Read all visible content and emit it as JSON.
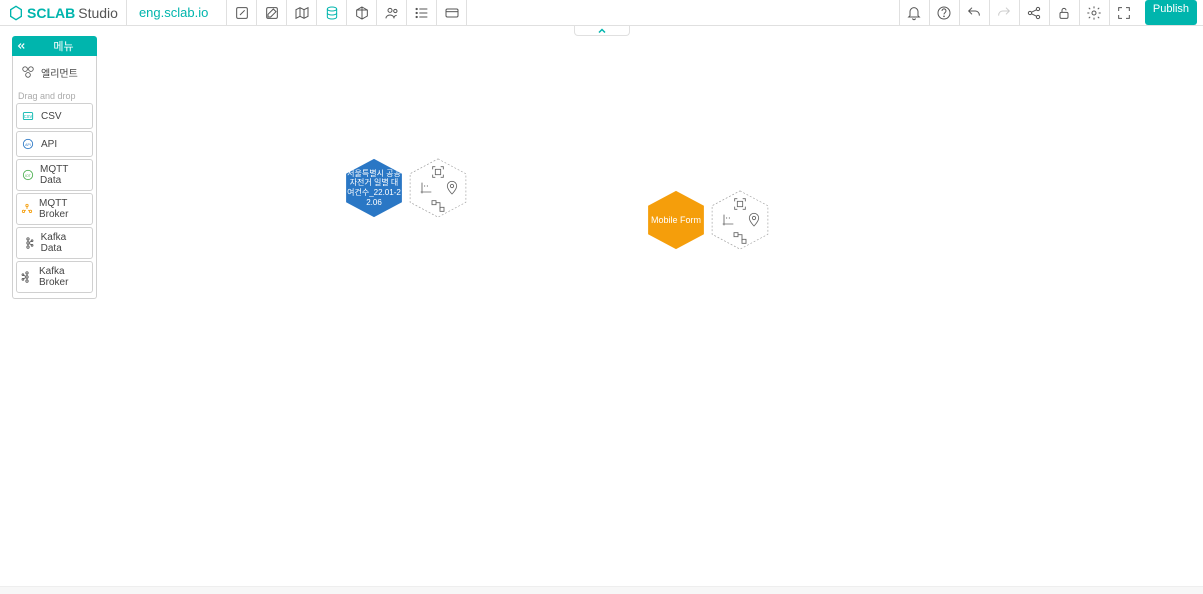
{
  "app": {
    "name_main": "SCLAB",
    "name_sub": "Studio"
  },
  "project": "eng.sclab.io",
  "publish_label": "Publish",
  "sidebar": {
    "title": "메뉴",
    "element_label": "엘리먼트",
    "section_label": "Drag and drop",
    "items": [
      {
        "label": "CSV"
      },
      {
        "label": "API"
      },
      {
        "label": "MQTT Data"
      },
      {
        "label": "MQTT Broker"
      },
      {
        "label": "Kafka Data"
      },
      {
        "label": "Kafka Broker"
      }
    ]
  },
  "nodes": {
    "n1": "서울특별시 공공자전거 일별 대여건수_22.01-22.06",
    "n2": "Mobile Form"
  }
}
